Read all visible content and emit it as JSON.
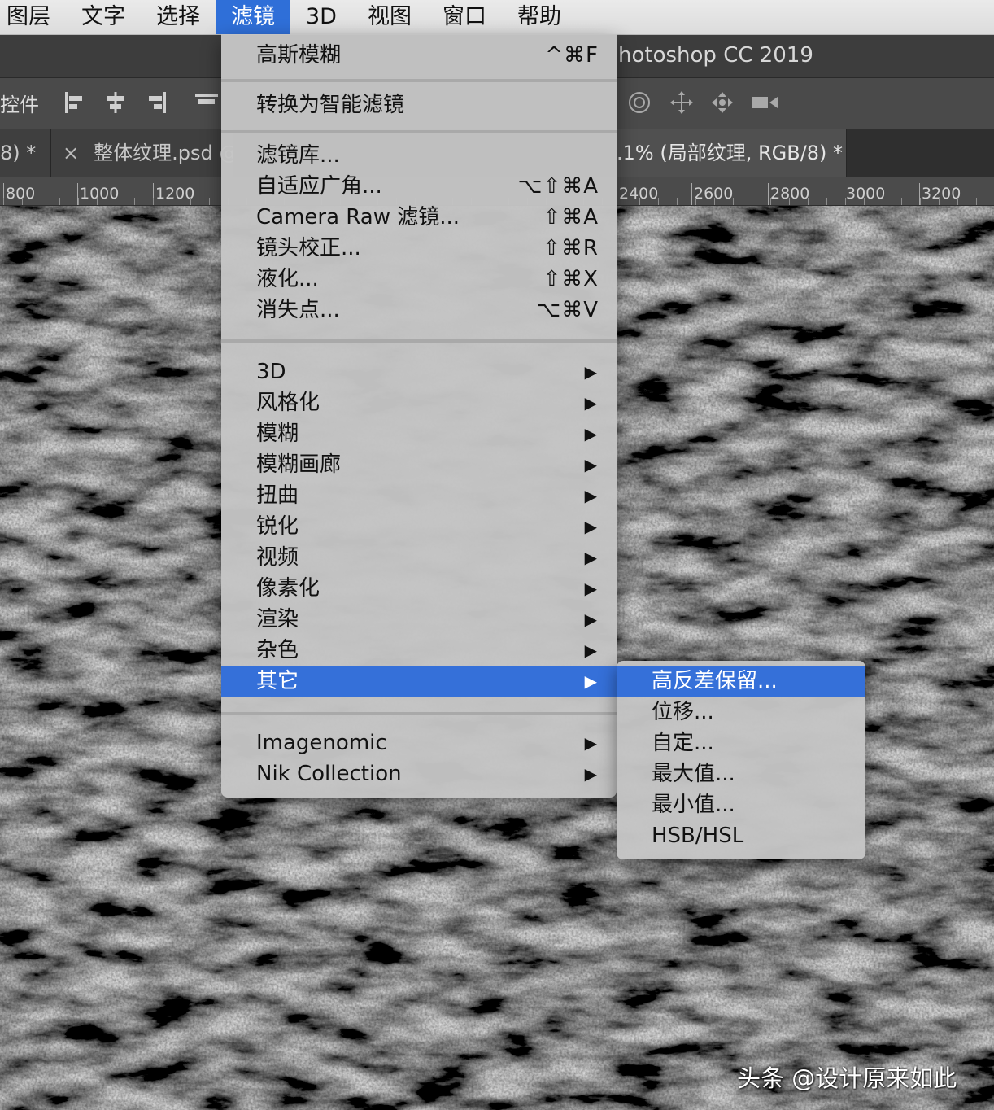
{
  "menubar": {
    "items": [
      {
        "label": "图层",
        "active": false
      },
      {
        "label": "文字",
        "active": false
      },
      {
        "label": "选择",
        "active": false
      },
      {
        "label": "滤镜",
        "active": true
      },
      {
        "label": "3D",
        "active": false
      },
      {
        "label": "视图",
        "active": false
      },
      {
        "label": "窗口",
        "active": false
      },
      {
        "label": "帮助",
        "active": false
      }
    ]
  },
  "titlebar": {
    "app_title": "hotoshop CC 2019"
  },
  "optionsbar": {
    "label": "控件",
    "icons": [
      "align-left-icon",
      "align-center-icon",
      "align-right-icon",
      "align-top-icon",
      "3d-orbit-icon",
      "3d-pan-icon",
      "3d-slide-icon",
      "3d-camera-icon"
    ]
  },
  "tabs": [
    {
      "label": "8) *",
      "closable": false,
      "active": false
    },
    {
      "label": "整体纹理.psd @",
      "closable": true,
      "active": false
    },
    {
      "label": ".1% (局部纹理, RGB/8) *",
      "closable": false,
      "active": true
    }
  ],
  "ruler": {
    "labels": [
      "800",
      "1000",
      "1200",
      "2400",
      "2600",
      "2800",
      "3000",
      "3200"
    ]
  },
  "filter_menu": {
    "groups": [
      [
        {
          "label": "高斯模糊",
          "shortcut": "^⌘F"
        }
      ],
      [
        {
          "label": "转换为智能滤镜",
          "shortcut": ""
        }
      ],
      [
        {
          "label": "滤镜库...",
          "shortcut": ""
        },
        {
          "label": "自适应广角...",
          "shortcut": "⌥⇧⌘A"
        },
        {
          "label": "Camera Raw 滤镜...",
          "shortcut": "⇧⌘A"
        },
        {
          "label": "镜头校正...",
          "shortcut": "⇧⌘R"
        },
        {
          "label": "液化...",
          "shortcut": "⇧⌘X"
        },
        {
          "label": "消失点...",
          "shortcut": "⌥⌘V"
        }
      ],
      [
        {
          "label": "3D",
          "submenu": true
        },
        {
          "label": "风格化",
          "submenu": true
        },
        {
          "label": "模糊",
          "submenu": true
        },
        {
          "label": "模糊画廊",
          "submenu": true
        },
        {
          "label": "扭曲",
          "submenu": true
        },
        {
          "label": "锐化",
          "submenu": true
        },
        {
          "label": "视频",
          "submenu": true
        },
        {
          "label": "像素化",
          "submenu": true
        },
        {
          "label": "渲染",
          "submenu": true
        },
        {
          "label": "杂色",
          "submenu": true
        },
        {
          "label": "其它",
          "submenu": true,
          "highlighted": true
        }
      ],
      [
        {
          "label": "Imagenomic",
          "submenu": true
        },
        {
          "label": "Nik Collection",
          "submenu": true
        }
      ]
    ],
    "arrow_glyph": "▶"
  },
  "submenu": {
    "items": [
      {
        "label": "高反差保留...",
        "highlighted": true
      },
      {
        "label": "位移...",
        "highlighted": false
      },
      {
        "label": "自定...",
        "highlighted": false
      },
      {
        "label": "最大值...",
        "highlighted": false
      },
      {
        "label": "最小值...",
        "highlighted": false
      },
      {
        "label": "HSB/HSL",
        "highlighted": false
      }
    ]
  },
  "watermark": {
    "text": "头条 @设计原来如此"
  },
  "colors": {
    "highlight": "#3570d9",
    "menubar_active": "#2f6fd8",
    "menu_bg": "#c4c4c4"
  }
}
